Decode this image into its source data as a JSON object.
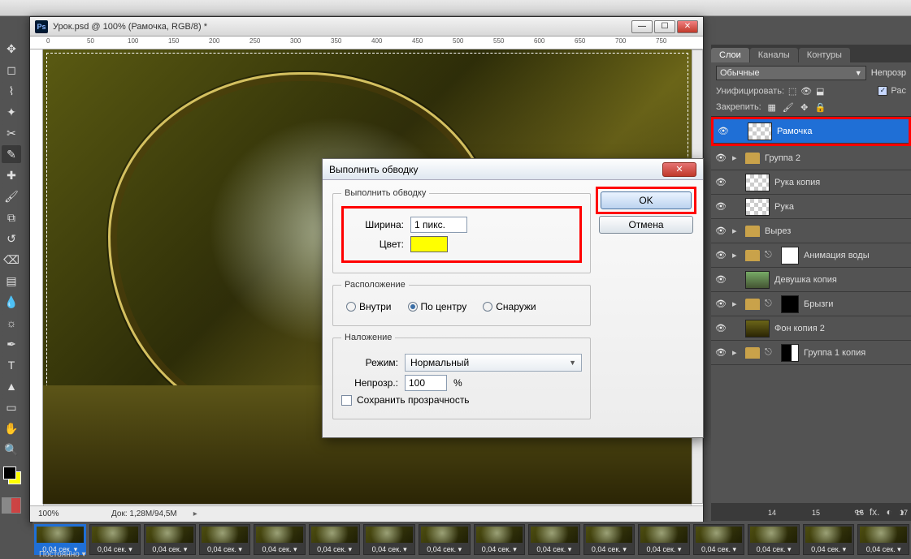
{
  "app": {
    "header": ""
  },
  "doc": {
    "title": "Урок.psd @ 100% (Рамочка, RGB/8) *",
    "zoom": "100%",
    "docinfo_label": "Док:",
    "docinfo_value": "1,28M/94,5M",
    "ruler_marks": [
      "0",
      "50",
      "100",
      "150",
      "200",
      "250",
      "300",
      "350",
      "400",
      "450",
      "500",
      "550",
      "600",
      "650",
      "700",
      "750"
    ]
  },
  "dialog": {
    "title": "Выполнить обводку",
    "group_stroke": "Выполнить обводку",
    "width_label": "Ширина:",
    "width_value": "1 пикс.",
    "color_label": "Цвет:",
    "color_value": "#ffff00",
    "group_location": "Расположение",
    "loc_inside": "Внутри",
    "loc_center": "По центру",
    "loc_outside": "Снаружи",
    "loc_selected": "center",
    "group_blend": "Наложение",
    "mode_label": "Режим:",
    "mode_value": "Нормальный",
    "opacity_label": "Непрозр.:",
    "opacity_value": "100",
    "opacity_pct": "%",
    "preserve": "Сохранить прозрачность",
    "ok": "OK",
    "cancel": "Отмена"
  },
  "panel": {
    "tabs": {
      "layers": "Слои",
      "channels": "Каналы",
      "paths": "Контуры"
    },
    "blend_mode": "Обычные",
    "opacity_label": "Непрозр",
    "unify_label": "Унифицировать:",
    "propagate_label": "Рас",
    "lock_label": "Закрепить:",
    "layers": [
      {
        "name": "Рамочка",
        "kind": "layer",
        "selected": true
      },
      {
        "name": "Группа 2",
        "kind": "group"
      },
      {
        "name": "Рука копия",
        "kind": "layer"
      },
      {
        "name": "Рука",
        "kind": "layer"
      },
      {
        "name": "Вырез",
        "kind": "group"
      },
      {
        "name": "Анимация воды",
        "kind": "group-mask"
      },
      {
        "name": "Девушка копия",
        "kind": "layer-img"
      },
      {
        "name": "Брызги",
        "kind": "group-mask"
      },
      {
        "name": "Фон копия 2",
        "kind": "layer-img"
      },
      {
        "name": "Группа 1 копия",
        "kind": "group-mask"
      }
    ]
  },
  "timeline": {
    "frame_label": "0,04 сек.",
    "selected_index": 0,
    "count": 16,
    "top_numbers": [
      "14",
      "15",
      "16",
      "17"
    ],
    "loop": "Постоянно"
  }
}
